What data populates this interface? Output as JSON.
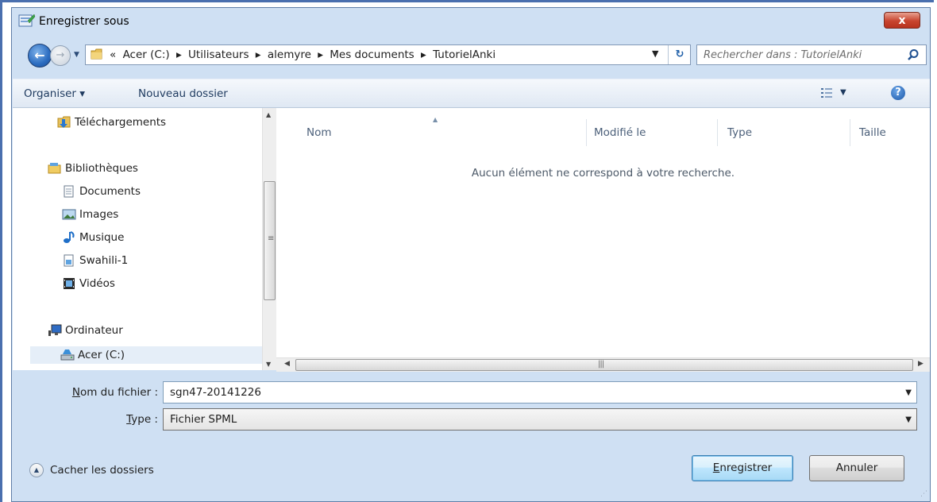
{
  "window": {
    "title": "Enregistrer sous",
    "close_label": "x"
  },
  "nav": {
    "back_label": "←",
    "forward_label": "→",
    "path": [
      "«",
      "Acer (C:)",
      "▸",
      "Utilisateurs",
      "▸",
      "alemyre",
      "▸",
      "Mes documents",
      "▸",
      "TutorielAnki"
    ],
    "refresh_label": "↻",
    "search_placeholder": "Rechercher dans : TutorielAnki"
  },
  "toolbar": {
    "organize_label": "Organiser ▾",
    "new_folder_label": "Nouveau dossier",
    "help_label": "?"
  },
  "sidebar": {
    "items": [
      {
        "label": "Téléchargements",
        "icon": "downloads-folder-icon"
      },
      {
        "label": "Bibliothèques",
        "icon": "libraries-icon"
      },
      {
        "label": "Documents",
        "icon": "documents-icon"
      },
      {
        "label": "Images",
        "icon": "images-icon"
      },
      {
        "label": "Musique",
        "icon": "music-icon"
      },
      {
        "label": "Swahili-1",
        "icon": "library-icon"
      },
      {
        "label": "Vidéos",
        "icon": "videos-icon"
      },
      {
        "label": "Ordinateur",
        "icon": "computer-icon"
      },
      {
        "label": "Acer (C:)",
        "icon": "drive-icon",
        "selected": true
      }
    ]
  },
  "content": {
    "columns": [
      "Nom",
      "Modifié le",
      "Type",
      "Taille"
    ],
    "empty_message": "Aucun élément ne correspond à votre recherche."
  },
  "form": {
    "filename_label_pre": "",
    "filename_label_u": "N",
    "filename_label_post": "om du fichier :",
    "filename_value": "sgn47-20141226",
    "type_label_u": "T",
    "type_label_post": "ype :",
    "type_value": "Fichier SPML"
  },
  "footer": {
    "hide_folders_label": "Cacher les dossiers",
    "save_label_u": "E",
    "save_label_post": "nregistrer",
    "cancel_label": "Annuler"
  },
  "colors": {
    "accent": "#2b6cc0",
    "close": "#c8442e",
    "toolbar": "#dfe8f3"
  }
}
